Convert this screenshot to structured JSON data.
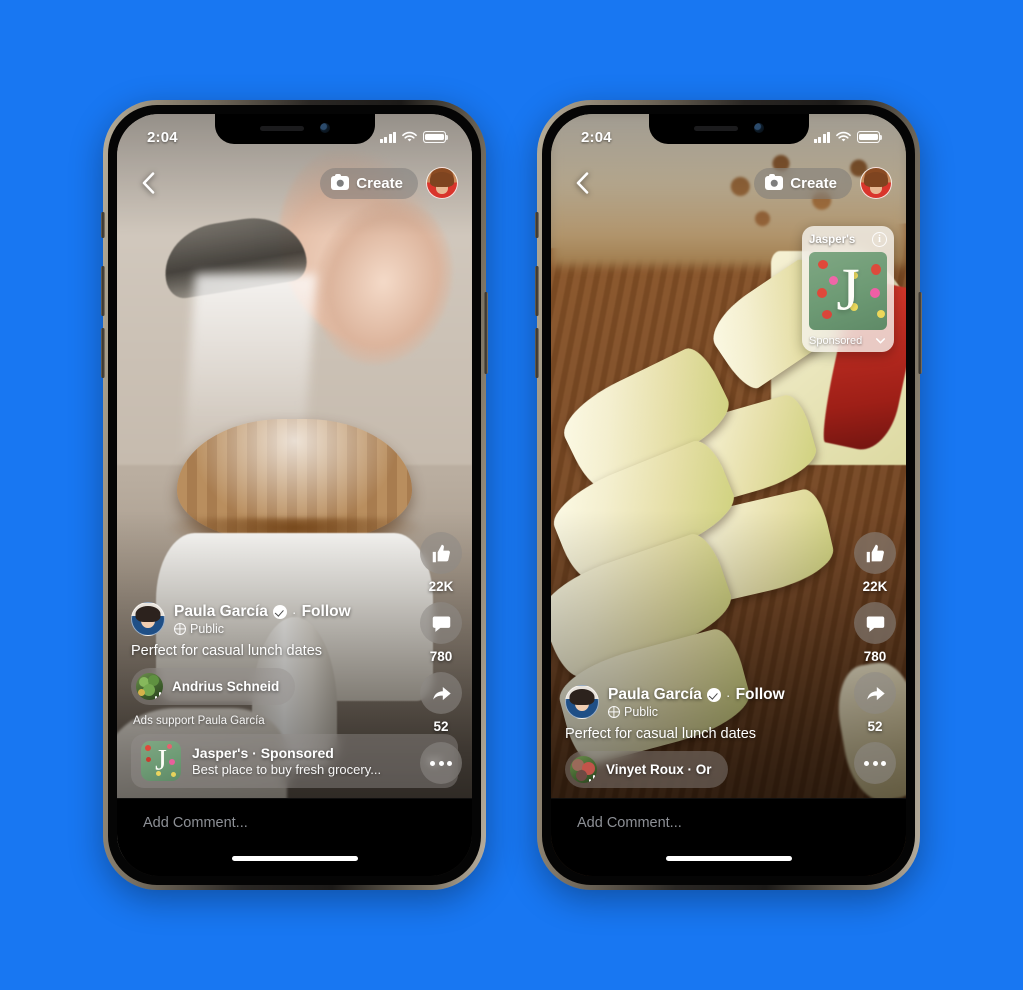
{
  "background_color": "#1877F2",
  "phones": [
    {
      "id": "left",
      "status_bar": {
        "time": "2:04"
      },
      "top_nav": {
        "back_label": "Back",
        "create_label": "Create"
      },
      "post": {
        "author_name": "Paula García",
        "verified": true,
        "separator": "·",
        "follow_label": "Follow",
        "privacy_label": "Public",
        "caption": "Perfect for casual lunch dates",
        "audio_label": "Andrius Schneid"
      },
      "ads_support": "Ads support Paula García",
      "sponsor_card": {
        "title": "Jasper's · Sponsored",
        "subtitle": "Best place to buy fresh grocery...",
        "logo_letter": "J"
      },
      "actions": [
        {
          "icon": "thumbs-up-icon",
          "count": "22K"
        },
        {
          "icon": "comment-icon",
          "count": "780"
        },
        {
          "icon": "share-icon",
          "count": "52"
        },
        {
          "icon": "more-icon",
          "count": ""
        }
      ],
      "comment_placeholder": "Add Comment..."
    },
    {
      "id": "right",
      "status_bar": {
        "time": "2:04"
      },
      "top_nav": {
        "back_label": "Back",
        "create_label": "Create"
      },
      "floating_ad": {
        "brand": "Jasper's",
        "info_glyph": "i",
        "sponsored_label": "Sponsored",
        "logo_letter": "J"
      },
      "post": {
        "author_name": "Paula García",
        "verified": true,
        "separator": "·",
        "follow_label": "Follow",
        "privacy_label": "Public",
        "caption": "Perfect for casual lunch dates",
        "audio_label": "Vinyet Roux · Or"
      },
      "actions": [
        {
          "icon": "thumbs-up-icon",
          "count": "22K"
        },
        {
          "icon": "comment-icon",
          "count": "780"
        },
        {
          "icon": "share-icon",
          "count": "52"
        },
        {
          "icon": "more-icon",
          "count": ""
        }
      ],
      "comment_placeholder": "Add Comment..."
    }
  ]
}
